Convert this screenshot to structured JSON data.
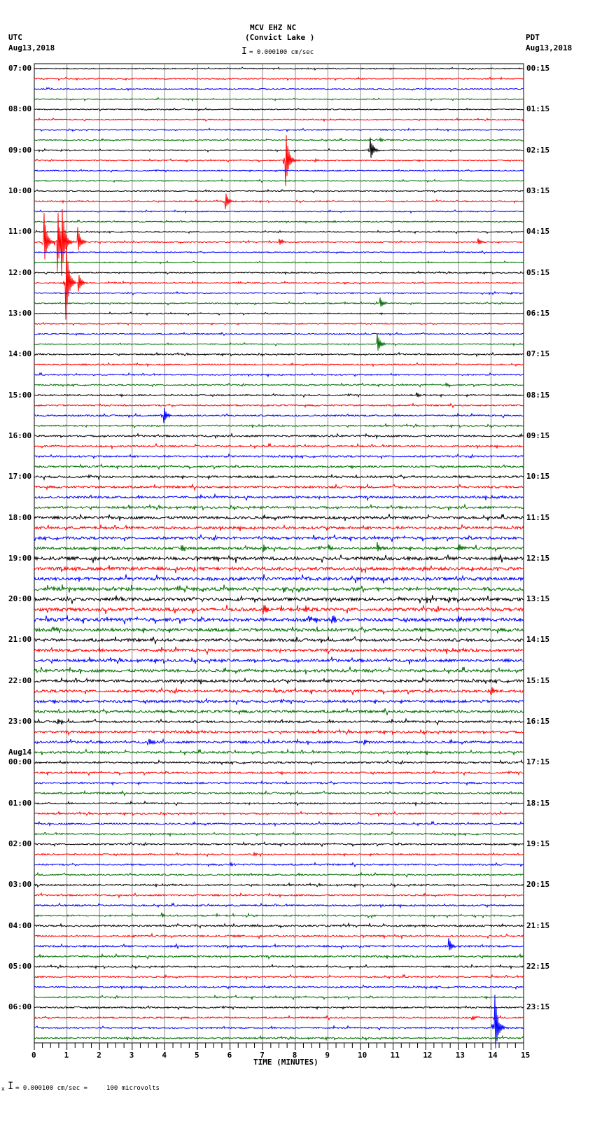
{
  "header": {
    "station": "MCV EHZ NC",
    "location": "(Convict Lake )",
    "left_tz": "UTC",
    "left_date": "Aug13,2018",
    "right_tz": "PDT",
    "right_date": "Aug13,2018",
    "scale": "= 0.000100 cm/sec"
  },
  "footer": {
    "scale": "= 0.000100 cm/sec =     100 microvolts",
    "mark": "x"
  },
  "chart_data": {
    "type": "line",
    "title": "MCV EHZ NC (Convict Lake )",
    "xlabel": "TIME (MINUTES)",
    "xlim": [
      0,
      15
    ],
    "x_ticks": [
      "0",
      "1",
      "2",
      "3",
      "4",
      "5",
      "6",
      "7",
      "8",
      "9",
      "10",
      "11",
      "12",
      "13",
      "14",
      "15"
    ],
    "left_labels": [
      {
        "trace": 0,
        "text": "07:00"
      },
      {
        "trace": 4,
        "text": "08:00"
      },
      {
        "trace": 8,
        "text": "09:00"
      },
      {
        "trace": 12,
        "text": "10:00"
      },
      {
        "trace": 16,
        "text": "11:00"
      },
      {
        "trace": 20,
        "text": "12:00"
      },
      {
        "trace": 24,
        "text": "13:00"
      },
      {
        "trace": 28,
        "text": "14:00"
      },
      {
        "trace": 32,
        "text": "15:00"
      },
      {
        "trace": 36,
        "text": "16:00"
      },
      {
        "trace": 40,
        "text": "17:00"
      },
      {
        "trace": 44,
        "text": "18:00"
      },
      {
        "trace": 48,
        "text": "19:00"
      },
      {
        "trace": 52,
        "text": "20:00"
      },
      {
        "trace": 56,
        "text": "21:00"
      },
      {
        "trace": 60,
        "text": "22:00"
      },
      {
        "trace": 64,
        "text": "23:00"
      },
      {
        "trace": 68,
        "text": "00:00",
        "date": "Aug14"
      },
      {
        "trace": 72,
        "text": "01:00"
      },
      {
        "trace": 76,
        "text": "02:00"
      },
      {
        "trace": 80,
        "text": "03:00"
      },
      {
        "trace": 84,
        "text": "04:00"
      },
      {
        "trace": 88,
        "text": "05:00"
      },
      {
        "trace": 92,
        "text": "06:00"
      }
    ],
    "right_labels": [
      "00:15",
      "01:15",
      "02:15",
      "03:15",
      "04:15",
      "05:15",
      "06:15",
      "07:15",
      "08:15",
      "09:15",
      "10:15",
      "11:15",
      "12:15",
      "13:15",
      "14:15",
      "15:15",
      "16:15",
      "17:15",
      "18:15",
      "19:15",
      "20:15",
      "21:15",
      "22:15",
      "23:15"
    ],
    "trace_count": 96,
    "trace_colors": [
      "#000000",
      "#ff0000",
      "#0000ff",
      "#007000"
    ],
    "noise_by_hour": [
      0.05,
      0.05,
      0.05,
      0.05,
      0.05,
      0.05,
      0.05,
      0.06,
      0.07,
      0.08,
      0.1,
      0.12,
      0.15,
      0.15,
      0.13,
      0.12,
      0.1,
      0.08,
      0.07,
      0.07,
      0.07,
      0.08,
      0.07,
      0.07
    ],
    "events": [
      {
        "trace": 7,
        "minute": 10.6,
        "amp": 0.2
      },
      {
        "trace": 8,
        "minute": 10.3,
        "amp": 1.3
      },
      {
        "trace": 9,
        "minute": 7.7,
        "amp": 3.3
      },
      {
        "trace": 9,
        "minute": 8.6,
        "amp": 0.15
      },
      {
        "trace": 13,
        "minute": 5.85,
        "amp": 1.0
      },
      {
        "trace": 15,
        "minute": 9.15,
        "amp": 0.15
      },
      {
        "trace": 17,
        "minute": 0.3,
        "amp": 2.8
      },
      {
        "trace": 17,
        "minute": 0.7,
        "amp": 4.0
      },
      {
        "trace": 17,
        "minute": 0.82,
        "amp": 4.2
      },
      {
        "trace": 17,
        "minute": 1.32,
        "amp": 1.5
      },
      {
        "trace": 17,
        "minute": 7.5,
        "amp": 0.4
      },
      {
        "trace": 17,
        "minute": 13.6,
        "amp": 0.4
      },
      {
        "trace": 21,
        "minute": 0.95,
        "amp": 5.5
      },
      {
        "trace": 21,
        "minute": 1.35,
        "amp": 1.0
      },
      {
        "trace": 23,
        "minute": 10.6,
        "amp": 0.6
      },
      {
        "trace": 27,
        "minute": 10.5,
        "amp": 1.2
      },
      {
        "trace": 31,
        "minute": 12.6,
        "amp": 0.15
      },
      {
        "trace": 32,
        "minute": 11.7,
        "amp": 0.3
      },
      {
        "trace": 34,
        "minute": 3.95,
        "amp": 1.2
      },
      {
        "trace": 47,
        "minute": 4.5,
        "amp": 0.35
      },
      {
        "trace": 47,
        "minute": 7.0,
        "amp": 0.45
      },
      {
        "trace": 47,
        "minute": 9.0,
        "amp": 0.4
      },
      {
        "trace": 47,
        "minute": 10.5,
        "amp": 0.8
      },
      {
        "trace": 47,
        "minute": 13.0,
        "amp": 0.5
      },
      {
        "trace": 52,
        "minute": 4.4,
        "amp": 0.2
      },
      {
        "trace": 53,
        "minute": 7.0,
        "amp": 0.7
      },
      {
        "trace": 53,
        "minute": 8.3,
        "amp": 0.35
      },
      {
        "trace": 54,
        "minute": 8.4,
        "amp": 0.5
      },
      {
        "trace": 54,
        "minute": 9.1,
        "amp": 0.8
      },
      {
        "trace": 54,
        "minute": 13.0,
        "amp": 0.5
      },
      {
        "trace": 55,
        "minute": 0.6,
        "amp": 0.3
      },
      {
        "trace": 61,
        "minute": 14.0,
        "amp": 0.4
      },
      {
        "trace": 66,
        "minute": 3.5,
        "amp": 0.5
      },
      {
        "trace": 66,
        "minute": 10.1,
        "amp": 0.4
      },
      {
        "trace": 64,
        "minute": 0.7,
        "amp": 0.3
      },
      {
        "trace": 65,
        "minute": 4.6,
        "amp": 0.3
      },
      {
        "trace": 78,
        "minute": 6.0,
        "amp": 0.2
      },
      {
        "trace": 77,
        "minute": 6.7,
        "amp": 0.2
      },
      {
        "trace": 83,
        "minute": 3.9,
        "amp": 0.3
      },
      {
        "trace": 86,
        "minute": 12.7,
        "amp": 0.8
      },
      {
        "trace": 93,
        "minute": 13.4,
        "amp": 0.3
      },
      {
        "trace": 94,
        "minute": 14.1,
        "amp": 4.2
      }
    ]
  }
}
